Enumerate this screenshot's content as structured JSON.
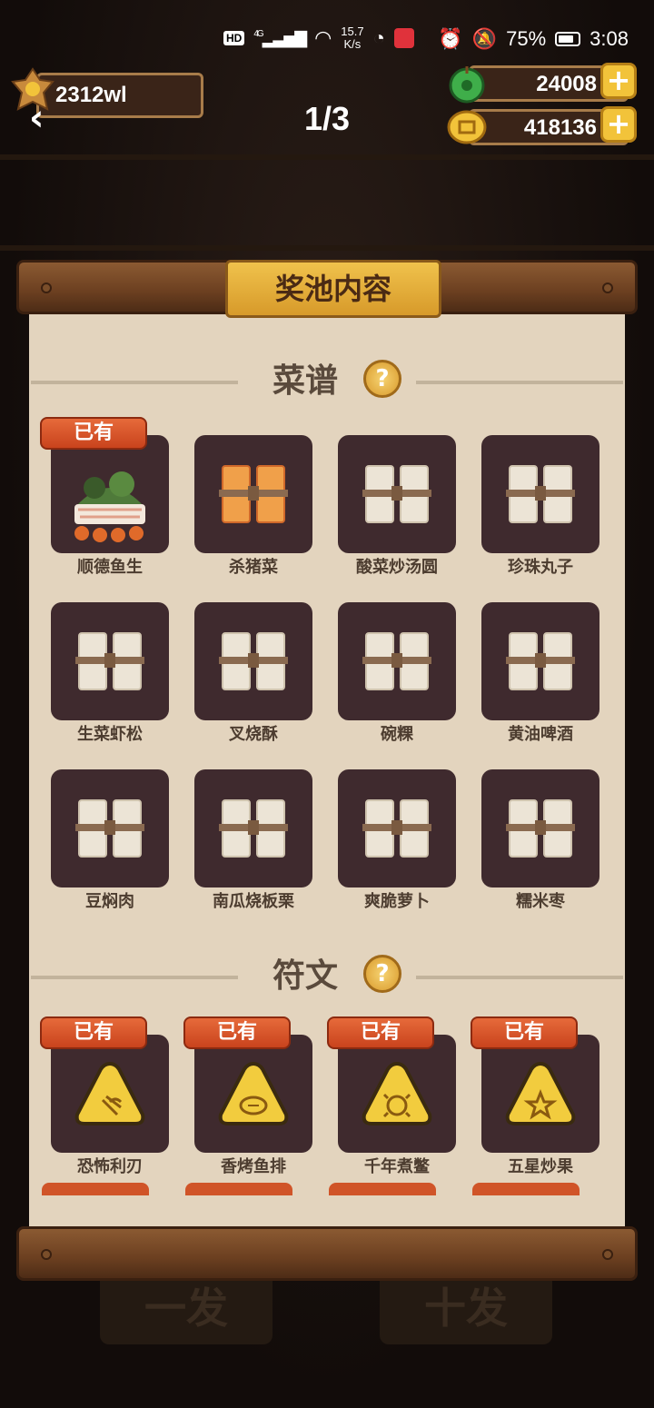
{
  "status_bar": {
    "hd": "HD",
    "network": "4G",
    "speed_value": "15.7",
    "speed_unit": "K/s",
    "battery": "75%",
    "time": "3:08"
  },
  "header": {
    "player_name": "2312wl",
    "page_indicator": "1/3",
    "jade_amount": "24008",
    "coin_amount": "418136"
  },
  "panel": {
    "title": "奖池内容",
    "owned_label": "已有",
    "help_glyph": "?",
    "sections": [
      {
        "label": "菜谱",
        "items": [
          {
            "name": "顺德鱼生",
            "owned": true,
            "icon": "dish-icon"
          },
          {
            "name": "杀猪菜",
            "owned": false,
            "icon": "orange-recipe-scroll-icon"
          },
          {
            "name": "酸菜炒汤圆",
            "owned": false,
            "icon": "recipe-scroll-icon"
          },
          {
            "name": "珍珠丸子",
            "owned": false,
            "icon": "recipe-scroll-icon"
          },
          {
            "name": "生菜虾松",
            "owned": false,
            "icon": "recipe-scroll-icon"
          },
          {
            "name": "叉烧酥",
            "owned": false,
            "icon": "recipe-scroll-icon"
          },
          {
            "name": "碗粿",
            "owned": false,
            "icon": "recipe-scroll-icon"
          },
          {
            "name": "黄油啤酒",
            "owned": false,
            "icon": "recipe-scroll-icon"
          },
          {
            "name": "豆焖肉",
            "owned": false,
            "icon": "recipe-scroll-icon"
          },
          {
            "name": "南瓜烧板栗",
            "owned": false,
            "icon": "recipe-scroll-icon"
          },
          {
            "name": "爽脆萝卜",
            "owned": false,
            "icon": "recipe-scroll-icon"
          },
          {
            "name": "糯米枣",
            "owned": false,
            "icon": "recipe-scroll-icon"
          }
        ]
      },
      {
        "label": "符文",
        "items": [
          {
            "name": "恐怖利刃",
            "owned": true,
            "icon": "rune-fork-icon"
          },
          {
            "name": "香烤鱼排",
            "owned": true,
            "icon": "rune-fish-icon"
          },
          {
            "name": "千年煮鳖",
            "owned": true,
            "icon": "rune-turtle-icon"
          },
          {
            "name": "五星炒果",
            "owned": true,
            "icon": "rune-star-icon"
          }
        ]
      }
    ]
  },
  "background_buttons": {
    "single_draw": "一发",
    "ten_draw": "十发"
  },
  "colors": {
    "paper": "#e3d4be",
    "tile": "#3f2a2e",
    "badge": "#d9552a",
    "gold": "#f2c33a"
  }
}
